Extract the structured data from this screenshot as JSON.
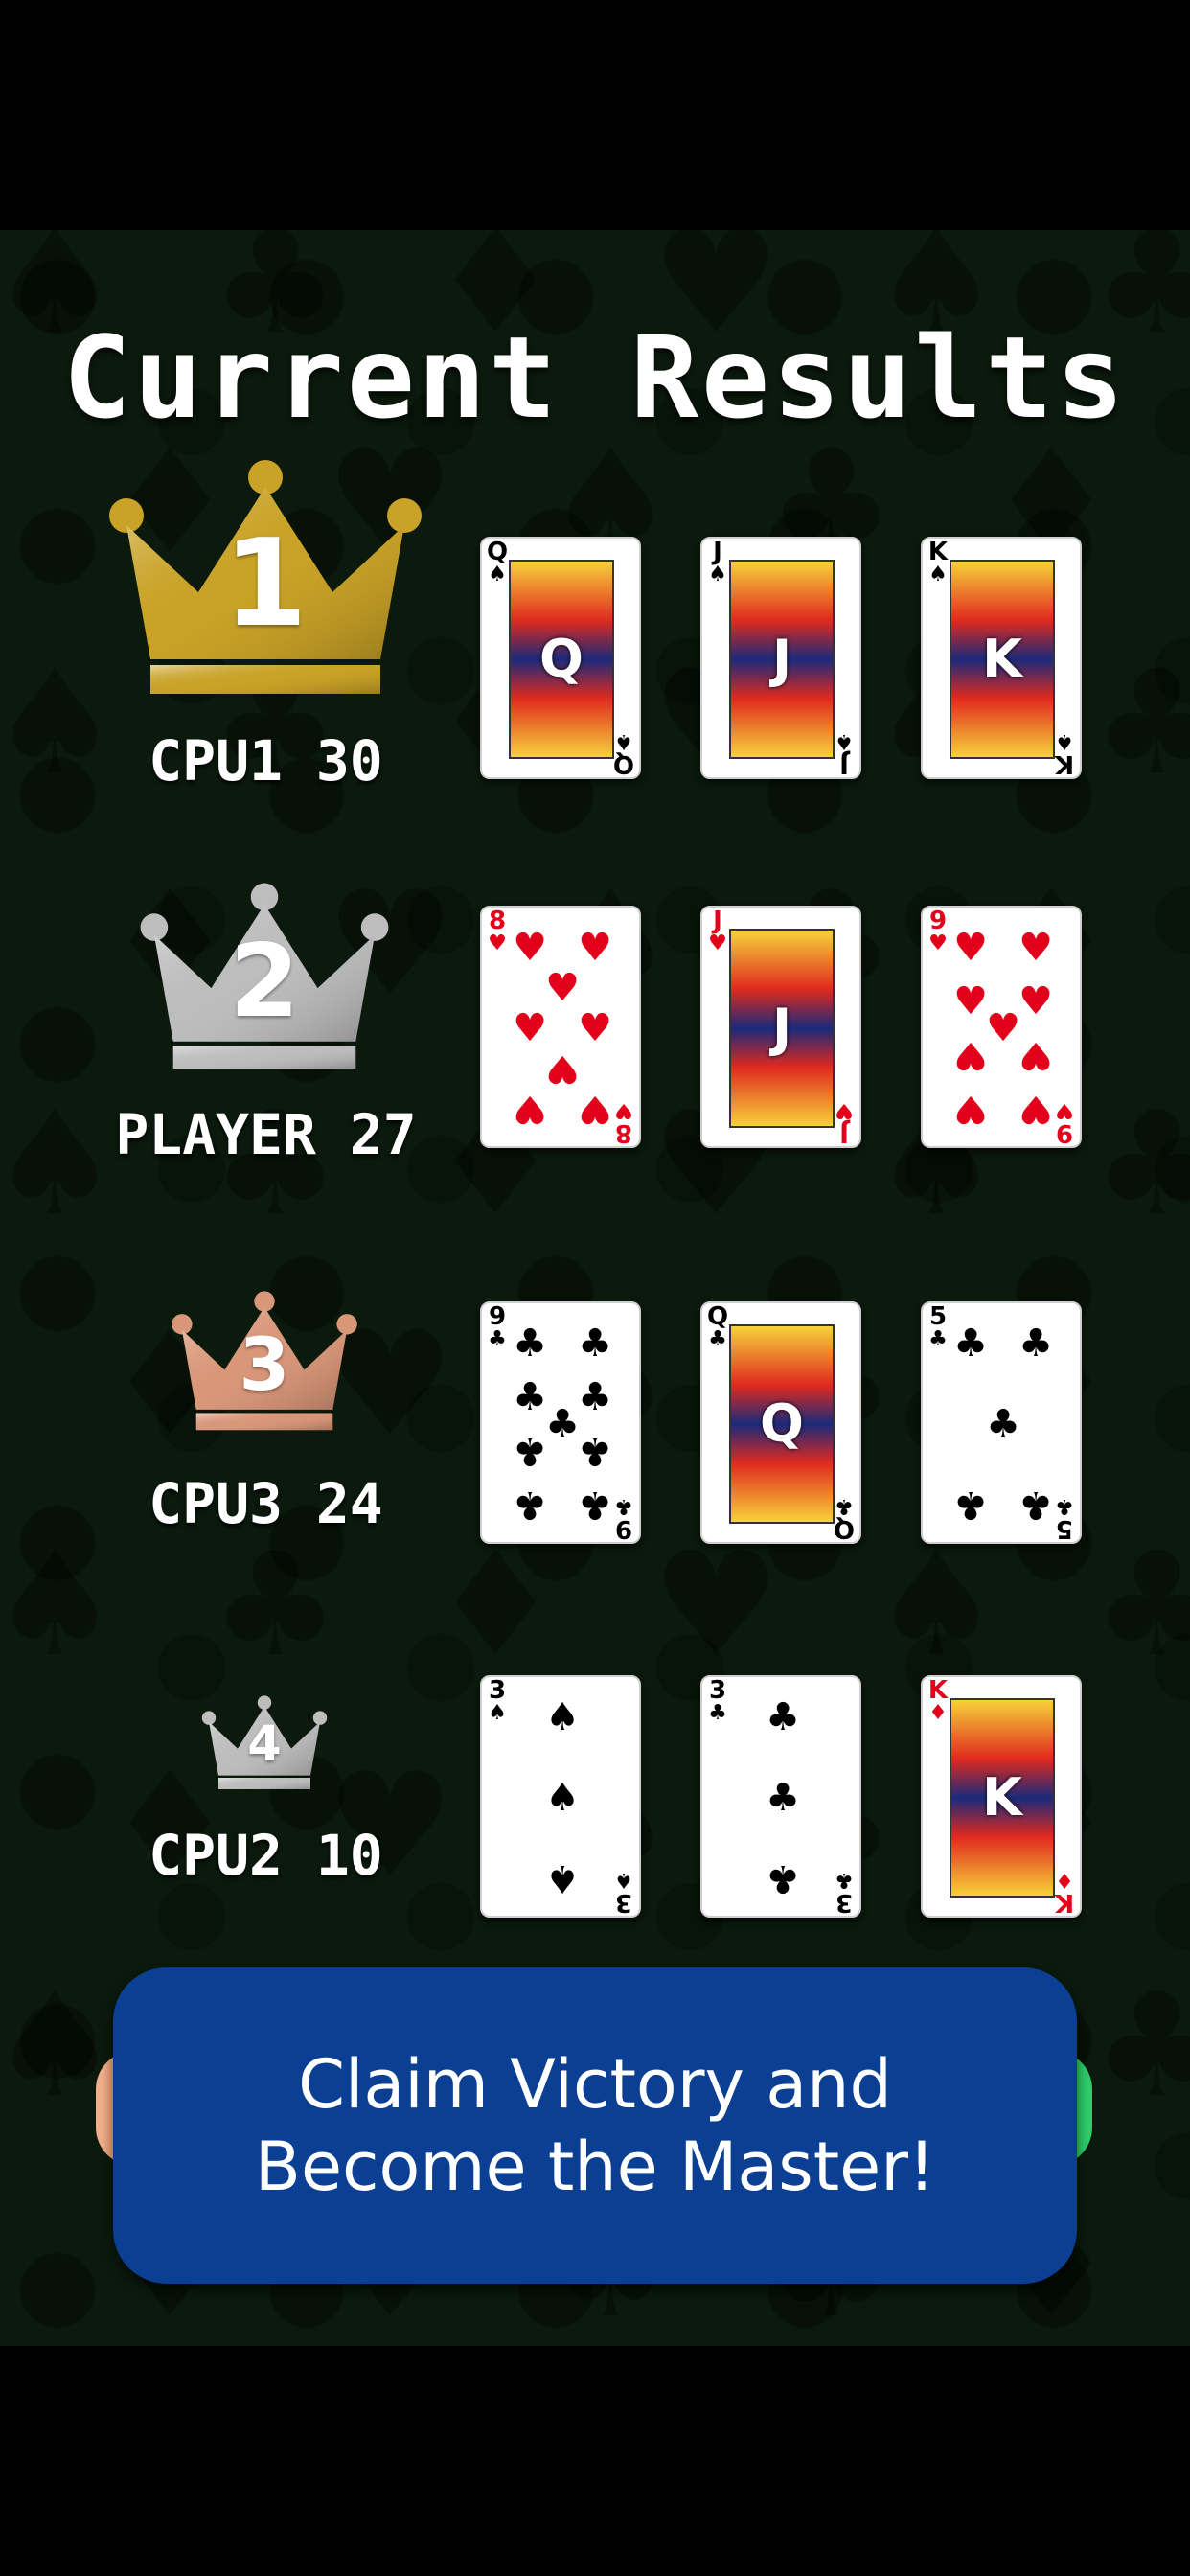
{
  "title": "Current Results",
  "results": [
    {
      "rank": "1",
      "name": "CPU1",
      "score": "30",
      "crown_color": "#c9a227",
      "cards": [
        {
          "rank": "Q",
          "suit": "♠",
          "color": "black"
        },
        {
          "rank": "J",
          "suit": "♠",
          "color": "black"
        },
        {
          "rank": "K",
          "suit": "♠",
          "color": "black"
        }
      ]
    },
    {
      "rank": "2",
      "name": "PLAYER",
      "score": "27",
      "crown_color": "#bdbdbd",
      "cards": [
        {
          "rank": "8",
          "suit": "♥",
          "color": "red"
        },
        {
          "rank": "J",
          "suit": "♥",
          "color": "red"
        },
        {
          "rank": "9",
          "suit": "♥",
          "color": "red"
        }
      ]
    },
    {
      "rank": "3",
      "name": "CPU3",
      "score": "24",
      "crown_color": "#d9977a",
      "cards": [
        {
          "rank": "9",
          "suit": "♣",
          "color": "black"
        },
        {
          "rank": "Q",
          "suit": "♣",
          "color": "black"
        },
        {
          "rank": "5",
          "suit": "♣",
          "color": "black"
        }
      ]
    },
    {
      "rank": "4",
      "name": "CPU2",
      "score": "10",
      "crown_color": "#bdbdbd",
      "cards": [
        {
          "rank": "3",
          "suit": "♠",
          "color": "black"
        },
        {
          "rank": "3",
          "suit": "♣",
          "color": "black"
        },
        {
          "rank": "K",
          "suit": "♦",
          "color": "red"
        }
      ]
    }
  ],
  "cta": {
    "label": "Claim Victory and Become the Master!",
    "color": "#0a3f93"
  }
}
